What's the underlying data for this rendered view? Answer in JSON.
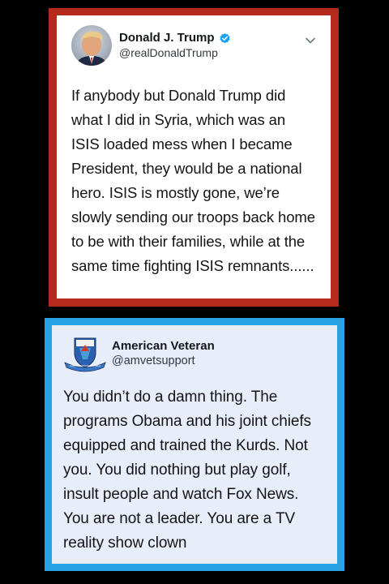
{
  "tweet1": {
    "display_name": "Donald J. Trump",
    "handle": "@realDonaldTrump",
    "verified": true,
    "avatar_icon": "profile-photo",
    "menu_icon": "chevron-down-icon",
    "text": "If anybody but Donald Trump did what I did in Syria, which was an ISIS loaded mess when I became President, they would be a national hero. ISIS is mostly gone, we’re slowly sending our troops back home to be with their families, while at the same time fighting ISIS remnants......",
    "frame_color": "#b52a1c"
  },
  "tweet2": {
    "display_name": "American Veteran",
    "handle": "@amvetsupport",
    "avatar_icon": "military-emblem-icon",
    "text": "You didn’t do a damn thing. The programs Obama and his joint chiefs equipped and trained the Kurds. Not you. You did nothing but play golf, insult people and watch Fox News. You are not a leader. You are a TV reality show clown",
    "frame_color": "#2aa3e6",
    "card_color": "#e8edfa"
  }
}
